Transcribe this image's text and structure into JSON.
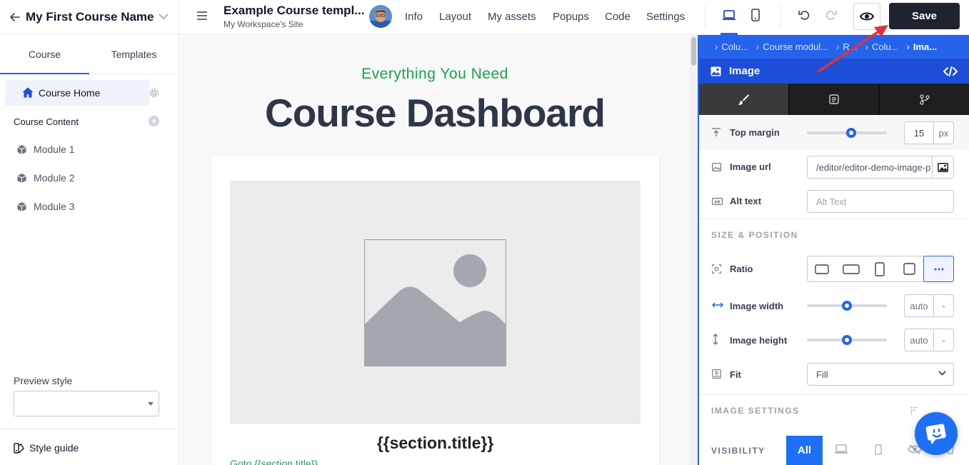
{
  "sidebar": {
    "course_name": "My First Course Name",
    "tabs": [
      {
        "label": "Course"
      },
      {
        "label": "Templates"
      }
    ],
    "home": {
      "label": "Course Home"
    },
    "content_title": "Course Content",
    "modules": [
      {
        "label": "Module 1"
      },
      {
        "label": "Module 2"
      },
      {
        "label": "Module 3"
      }
    ],
    "preview_style_label": "Preview style",
    "preview_style_value": "",
    "style_guide": "Style guide"
  },
  "topbar": {
    "title": "Example Course templ...",
    "subtitle": "My Workspace's Site",
    "nav": [
      {
        "label": "Info"
      },
      {
        "label": "Layout"
      },
      {
        "label": "My assets"
      },
      {
        "label": "Popups"
      },
      {
        "label": "Code"
      },
      {
        "label": "Settings"
      }
    ],
    "save_label": "Save"
  },
  "canvas": {
    "kicker": "Everything You Need",
    "heading": "Course Dashboard",
    "section_title": "{{section.title}}",
    "goto_link": "Goto {{section.title}}"
  },
  "panel": {
    "breadcrumbs": [
      {
        "label": "Colu..."
      },
      {
        "label": "Course modul..."
      },
      {
        "label": "R..."
      },
      {
        "label": "Colu..."
      },
      {
        "label": "Ima..."
      }
    ],
    "element_title": "Image",
    "top_margin": {
      "label": "Top margin",
      "value": "15",
      "unit": "px",
      "slider_fraction": 0.55
    },
    "image_url": {
      "label": "Image url",
      "value": "/editor/editor-demo-image-p"
    },
    "alt_text": {
      "label": "Alt text",
      "placeholder": "Alt Text"
    },
    "size_position_title": "SIZE & POSITION",
    "ratio": {
      "label": "Ratio",
      "options": [
        "square-outline",
        "wide",
        "portrait",
        "square",
        "more"
      ],
      "selected": "more"
    },
    "image_width": {
      "label": "Image width",
      "value": "auto",
      "unit": "-",
      "slider_fraction": 0.5
    },
    "image_height": {
      "label": "Image height",
      "value": "auto",
      "unit": "-",
      "slider_fraction": 0.5
    },
    "fit": {
      "label": "Fit",
      "value": "Fill"
    },
    "image_settings_title": "IMAGE SETTINGS",
    "visibility": {
      "label": "VISIBILITY",
      "all_label": "All"
    }
  },
  "colors": {
    "accent": "#2563eb",
    "save_bg": "#1e2330",
    "kicker_green": "#16a34a",
    "heading": "#2d3748",
    "annotation_arrow": "#e0323c"
  }
}
